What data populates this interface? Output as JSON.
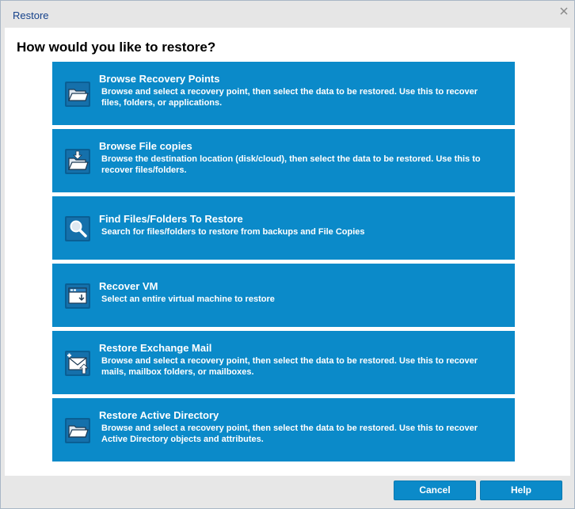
{
  "dialog": {
    "title": "Restore",
    "question": "How would you like to restore?"
  },
  "options": [
    {
      "title": "Browse Recovery Points",
      "description": "Browse and select a recovery point, then select the data to be restored. Use this to recover files, folders, or applications.",
      "icon": "folder-open-icon"
    },
    {
      "title": "Browse File copies",
      "description": "Browse the destination location (disk/cloud), then select the data to be restored. Use this to recover files/folders.",
      "icon": "folder-download-icon"
    },
    {
      "title": "Find Files/Folders To Restore",
      "description": "Search for files/folders to restore from backups and File Copies",
      "icon": "search-icon"
    },
    {
      "title": "Recover VM",
      "description": "Select an entire virtual machine to restore",
      "icon": "vm-window-icon"
    },
    {
      "title": "Restore Exchange Mail",
      "description": "Browse and select a recovery point, then select the data to be restored. Use this to recover mails, mailbox folders, or mailboxes.",
      "icon": "mail-restore-icon"
    },
    {
      "title": "Restore Active Directory",
      "description": "Browse and select a recovery point, then select the data to be restored. Use this to recover Active Directory objects and attributes.",
      "icon": "folder-open-icon"
    }
  ],
  "buttons": {
    "cancel": "Cancel",
    "help": "Help"
  },
  "colors": {
    "option_background": "#0b8ac9",
    "title_text": "#15428b"
  }
}
